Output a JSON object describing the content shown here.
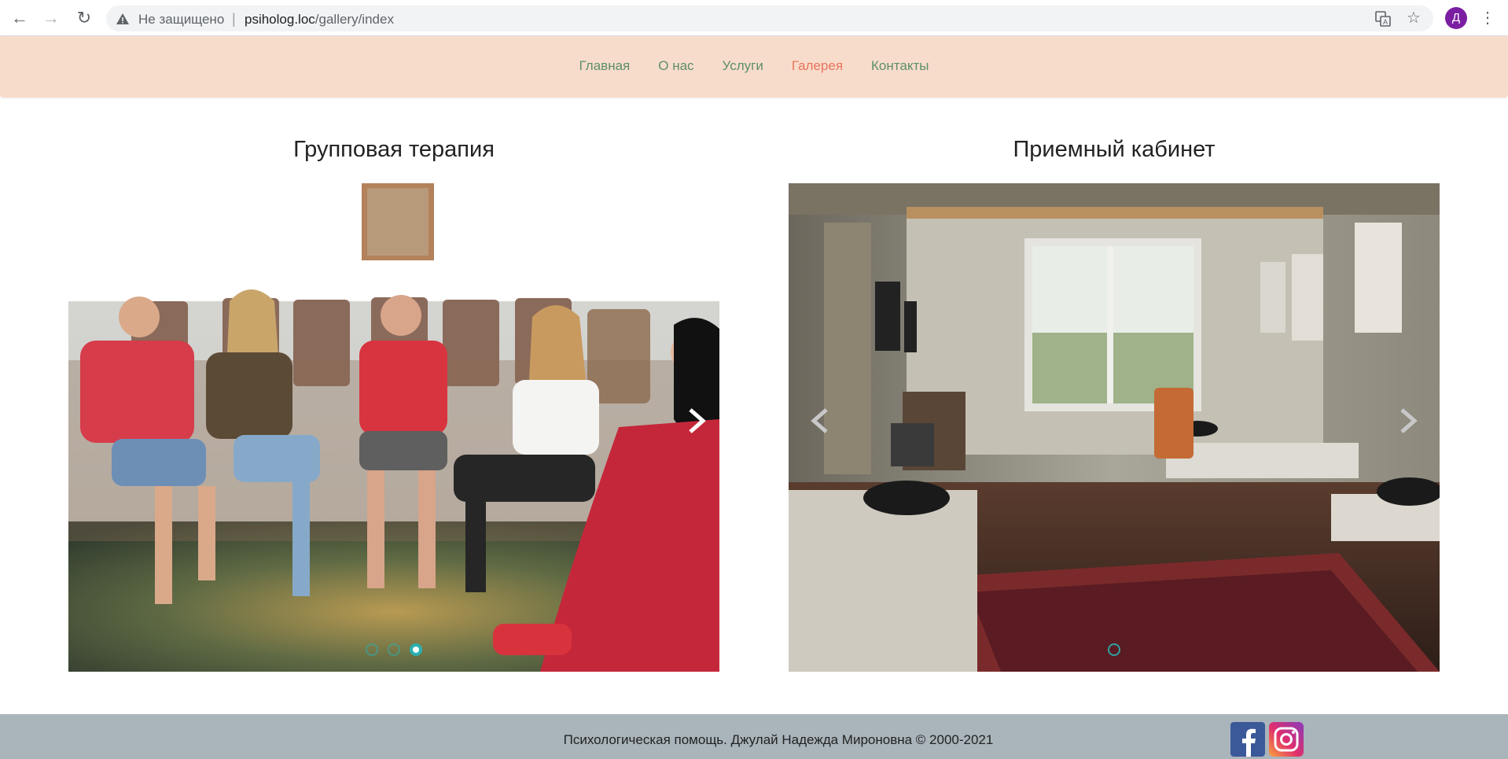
{
  "browser": {
    "security_label": "Не защищено",
    "url_host": "psiholog.loc",
    "url_path": "/gallery/index",
    "profile_initial": "Д"
  },
  "nav": {
    "items": [
      {
        "label": "Главная",
        "active": false
      },
      {
        "label": "О нас",
        "active": false
      },
      {
        "label": "Услуги",
        "active": false
      },
      {
        "label": "Галерея",
        "active": true
      },
      {
        "label": "Контакты",
        "active": false
      }
    ]
  },
  "galleries": [
    {
      "title": "Групповая терапия",
      "slides": 3,
      "active_slide": 3
    },
    {
      "title": "Приемный кабинет",
      "slides": 1,
      "active_slide": 1
    }
  ],
  "footer": {
    "copyright": "Психологическая помощь. Джулай Надежда Мироновна © 2000-2021",
    "social": [
      "facebook-icon",
      "instagram-icon"
    ]
  },
  "colors": {
    "navbar_bg": "#f8dccb",
    "nav_link": "#5c8f6a",
    "nav_active": "#e8735d",
    "footer_bg": "#a9b4bb",
    "indicator": "#2ab0b0"
  }
}
